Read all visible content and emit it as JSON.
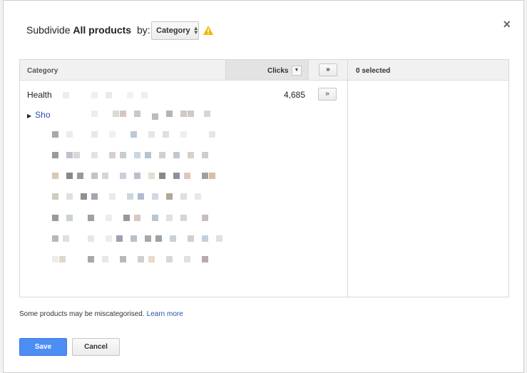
{
  "dialog": {
    "title_prefix": "Subdivide",
    "title_bold": "All products",
    "title_suffix": "by:",
    "dimension_select": "Category",
    "close_label": "×"
  },
  "table": {
    "column_category": "Category",
    "column_clicks": "Clicks",
    "add_all_label": "»",
    "selected_label": "0 selected",
    "rows": [
      {
        "label": "Health",
        "clicks": "4,685",
        "add_label": "»"
      },
      {
        "label": "Sho",
        "expandable": true
      }
    ]
  },
  "footer": {
    "note": "Some products may be miscategorised.",
    "learn_more": "Learn more",
    "save_label": "Save",
    "cancel_label": "Cancel"
  },
  "colors": {
    "primary_button": "#4d8ef4",
    "link": "#2a4fb0",
    "warning": "#f4b400"
  },
  "icons": [
    "close-icon",
    "sort-arrows-icon",
    "warning-icon",
    "dropdown-arrow-icon",
    "expand-triangle-icon"
  ]
}
